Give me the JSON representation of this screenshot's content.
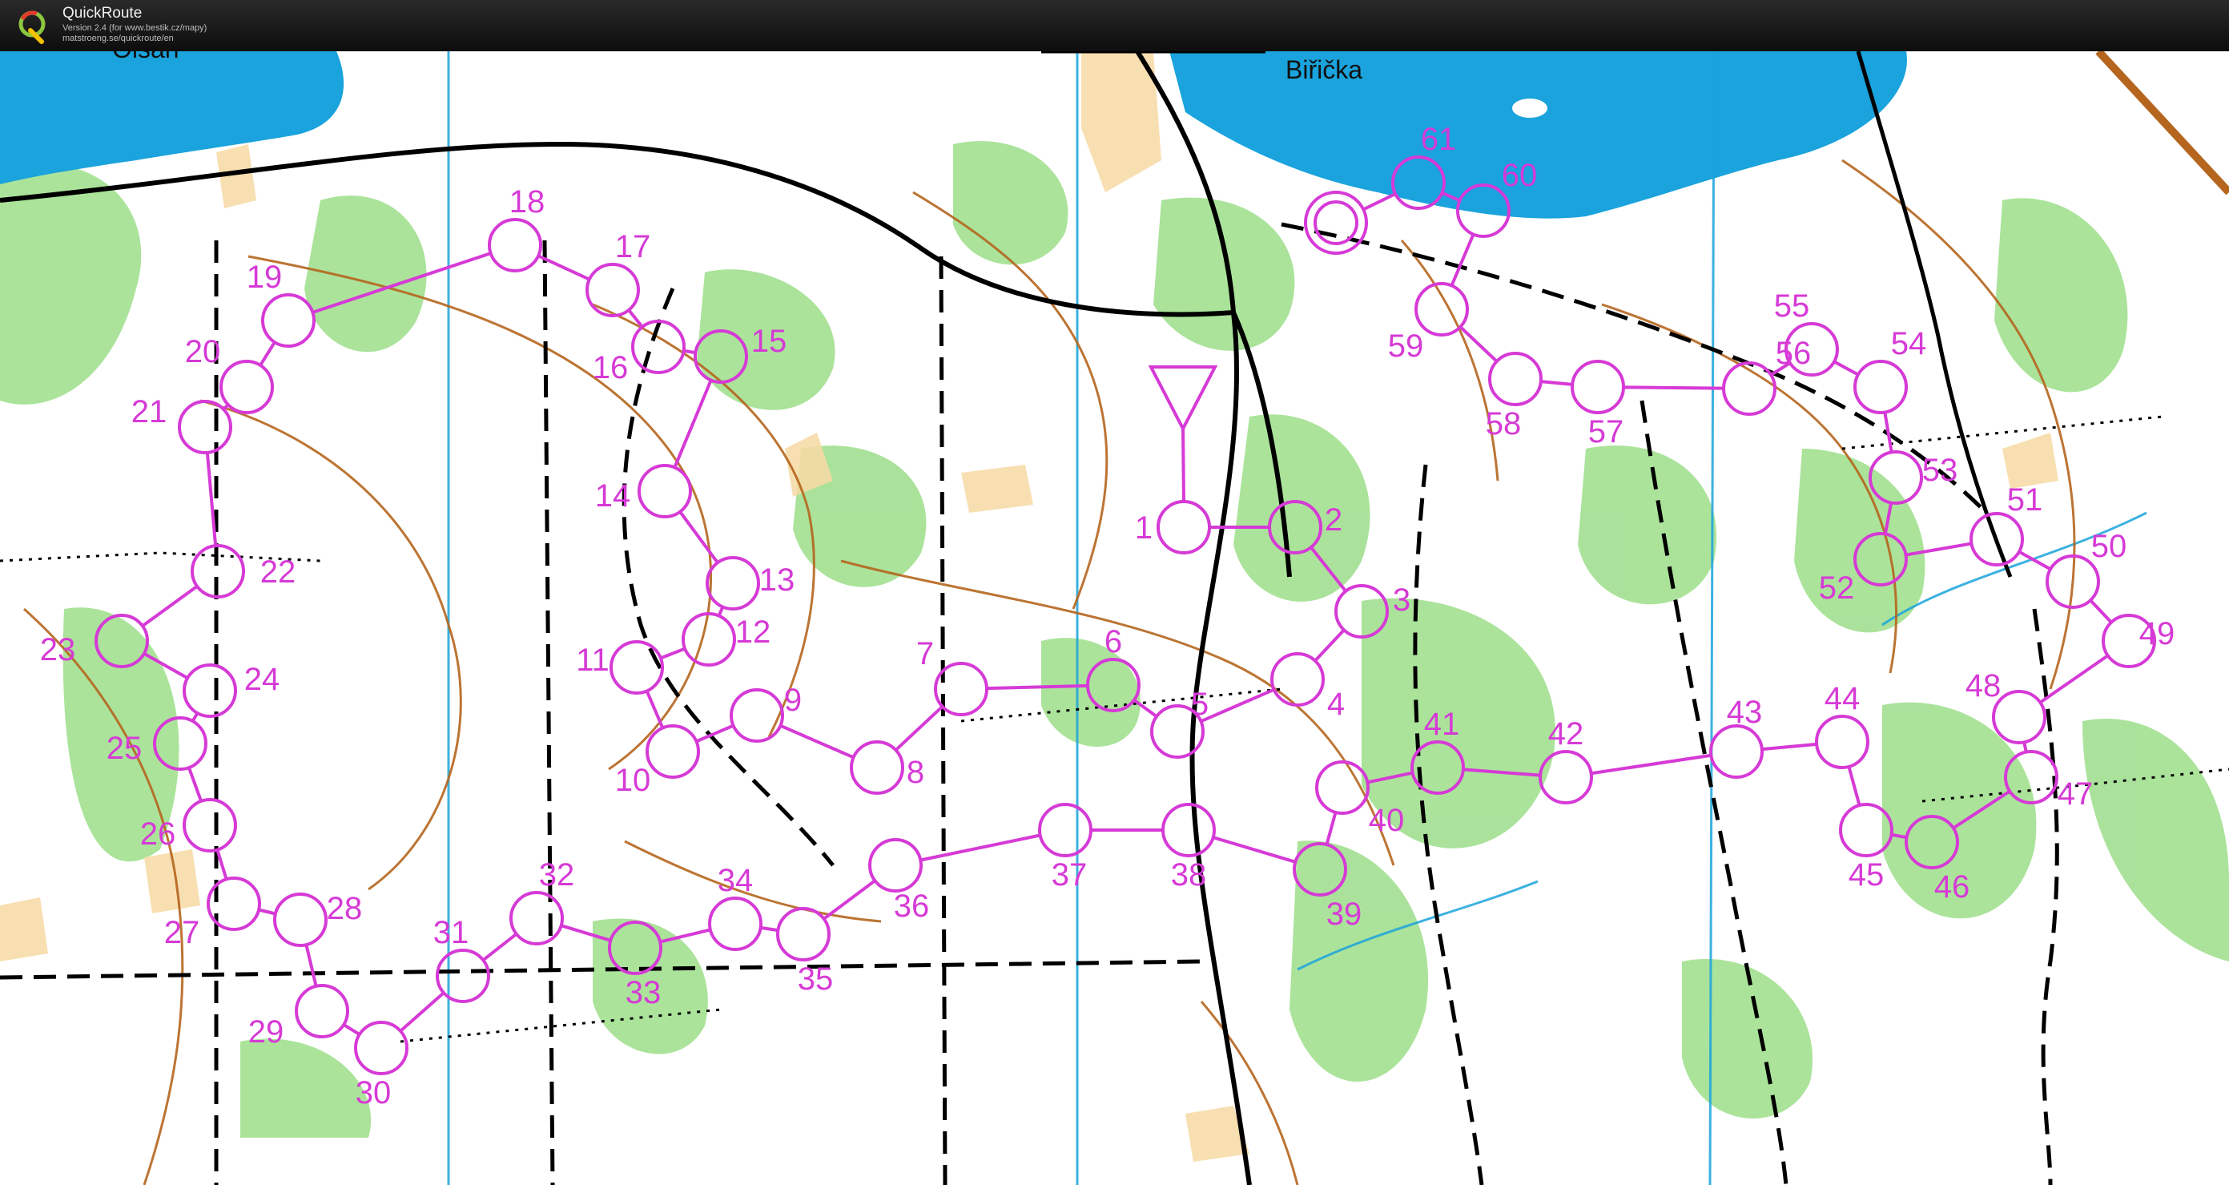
{
  "app": {
    "title": "QuickRoute",
    "version": "Version 2.4  (for www.bestik.cz/mapy)",
    "url": "matstroeng.se/quickroute/en",
    "logo_letter": "Q"
  },
  "map": {
    "place_names": [
      "Olšan",
      "Biřička"
    ],
    "course_color": "#d63ad6",
    "water_color": "#1aa3dc",
    "forest_color": "#8fd97a",
    "contour_color": "#b5651d",
    "start_label": "Start",
    "controls": [
      "1",
      "2",
      "3",
      "4",
      "5",
      "6",
      "7",
      "8",
      "9",
      "10",
      "11",
      "12",
      "13",
      "14",
      "15",
      "16",
      "17",
      "18",
      "19",
      "20",
      "21",
      "22",
      "23",
      "24",
      "25",
      "26",
      "27",
      "28",
      "29",
      "30",
      "31",
      "32",
      "33",
      "34",
      "35",
      "36",
      "37",
      "38",
      "39",
      "40",
      "41",
      "42",
      "43",
      "44",
      "45",
      "46",
      "47",
      "48",
      "49",
      "50",
      "51",
      "52",
      "53",
      "54",
      "55",
      "56",
      "57",
      "58",
      "59",
      "60",
      "61"
    ]
  }
}
